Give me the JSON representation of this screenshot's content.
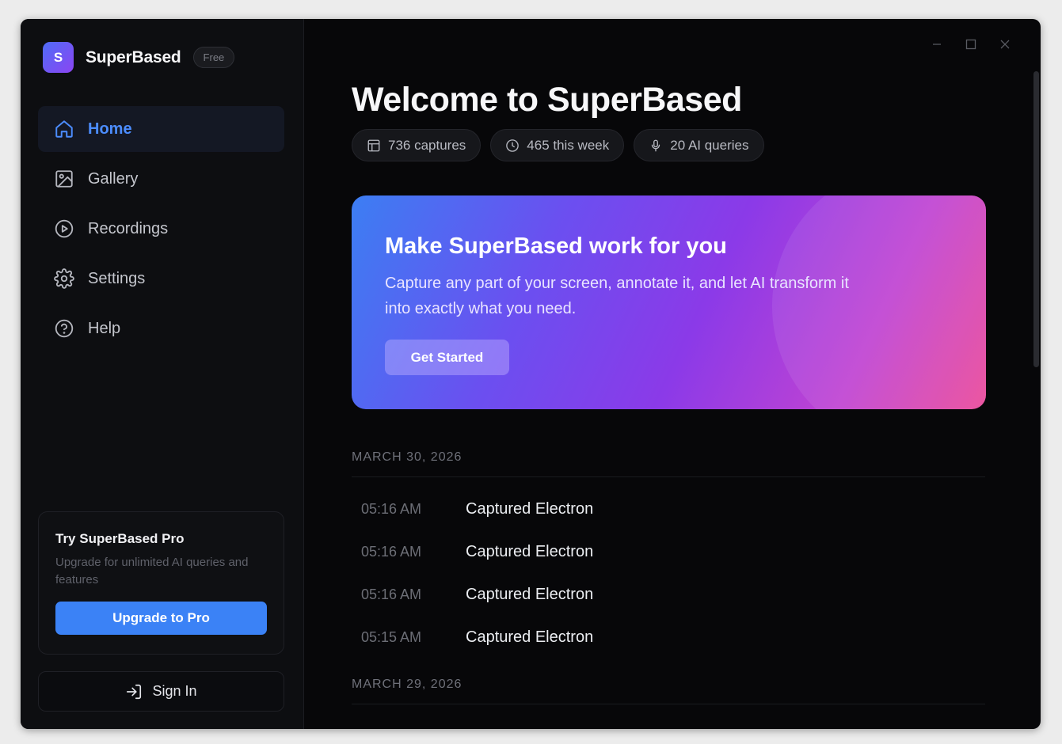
{
  "app": {
    "name": "SuperBased",
    "logo_letter": "S",
    "plan_badge": "Free"
  },
  "sidebar": {
    "items": [
      {
        "label": "Home",
        "icon": "home-icon",
        "active": true
      },
      {
        "label": "Gallery",
        "icon": "image-icon",
        "active": false
      },
      {
        "label": "Recordings",
        "icon": "play-circle-icon",
        "active": false
      },
      {
        "label": "Settings",
        "icon": "gear-icon",
        "active": false
      },
      {
        "label": "Help",
        "icon": "help-circle-icon",
        "active": false
      }
    ],
    "pro_card": {
      "title": "Try SuperBased Pro",
      "description": "Upgrade for unlimited AI queries and features",
      "button": "Upgrade to Pro"
    },
    "sign_in": "Sign In"
  },
  "main": {
    "title": "Welcome to SuperBased",
    "stats": [
      {
        "label": "736 captures",
        "icon": "table-icon"
      },
      {
        "label": "465 this week",
        "icon": "clock-icon"
      },
      {
        "label": "20 AI queries",
        "icon": "microphone-icon"
      }
    ],
    "hero": {
      "title": "Make SuperBased work for you",
      "description": "Capture any part of your screen, annotate it, and let AI transform it into exactly what you need.",
      "button": "Get Started"
    },
    "groups": [
      {
        "date": "MARCH 30, 2026",
        "entries": [
          {
            "time": "05:16 AM",
            "text": "Captured Electron"
          },
          {
            "time": "05:16 AM",
            "text": "Captured Electron"
          },
          {
            "time": "05:16 AM",
            "text": "Captured Electron"
          },
          {
            "time": "05:15 AM",
            "text": "Captured Electron"
          }
        ]
      },
      {
        "date": "MARCH 29, 2026",
        "entries": []
      }
    ]
  },
  "colors": {
    "accent": "#3b82f6",
    "active_nav_text": "#4c8dff",
    "background": "#070709",
    "sidebar": "#0d0e11"
  }
}
